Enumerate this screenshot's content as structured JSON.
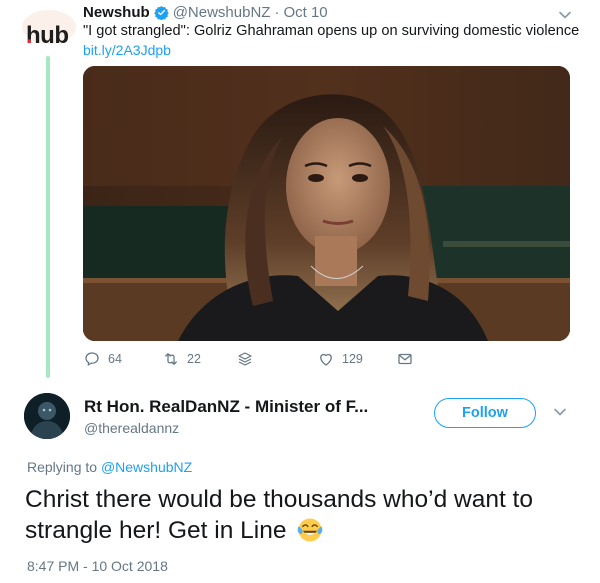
{
  "quoted_tweet": {
    "logo_text": "hub",
    "logo_dot": ".",
    "author_name": "Newshub",
    "handle": "@NewshubNZ",
    "separator": "·",
    "date": "Oct 10",
    "text": "\"I got strangled\": Golriz Ghahraman opens up on surviving domestic violence",
    "link": "bit.ly/2A3Jdpb",
    "actions": {
      "reply_count": "64",
      "retweet_count": "22",
      "like_count": "129"
    },
    "icons": [
      "verified-badge-icon",
      "chevron-down-icon",
      "reply-icon",
      "retweet-icon",
      "stack-icon",
      "heart-icon",
      "message-icon"
    ]
  },
  "reply_tweet": {
    "display_name": "Rt Hon. RealDanNZ - Minister of F...",
    "handle": "@therealdannz",
    "follow_label": "Follow",
    "replying_prefix": "Replying to ",
    "replying_mention": "@NewshubNZ",
    "body": "Christ there would be thousands who’d want to strangle her! Get in Line",
    "emoji": "face-with-tears-of-joy",
    "timestamp": "8:47 PM - 10 Oct 2018"
  },
  "colors": {
    "accent": "#1da1f2",
    "muted": "#657786",
    "thread_line": "#a6e8c2",
    "brand_dot": "#e02f3c"
  }
}
